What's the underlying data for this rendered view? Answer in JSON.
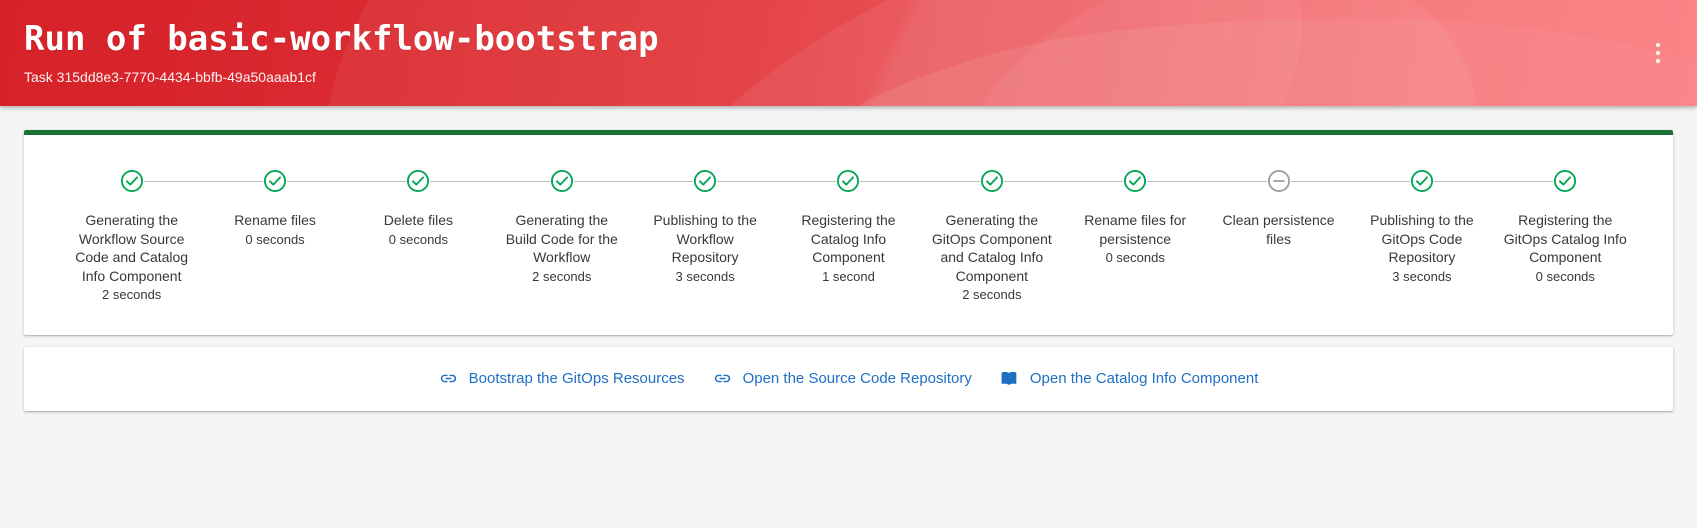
{
  "header": {
    "title": "Run of basic-workflow-bootstrap",
    "subtitle": "Task 315dd8e3-7770-4434-bbfb-49a50aaab1cf",
    "menu_icon": "kebab-vertical-icon",
    "gradient_from": "#d62128",
    "gradient_to": "#fa7175"
  },
  "card": {
    "accent_color": "#1a7037"
  },
  "colors": {
    "step_success": "#00a651",
    "step_skipped": "#9e9e9e",
    "connector": "#bdbdbd",
    "link": "#1f6fc4",
    "text": "#35393d"
  },
  "stepper": {
    "steps": [
      {
        "label": "Generating the Workflow Source Code and Catalog Info Component",
        "time": "2 seconds",
        "status": "success",
        "icon": "check-circle-icon"
      },
      {
        "label": "Rename files",
        "time": "0 seconds",
        "status": "success",
        "icon": "check-circle-icon"
      },
      {
        "label": "Delete files",
        "time": "0 seconds",
        "status": "success",
        "icon": "check-circle-icon"
      },
      {
        "label": "Generating the Build Code for the Workflow",
        "time": "2 seconds",
        "status": "success",
        "icon": "check-circle-icon"
      },
      {
        "label": "Publishing to the Workflow Repository",
        "time": "3 seconds",
        "status": "success",
        "icon": "check-circle-icon"
      },
      {
        "label": "Registering the Catalog Info Component",
        "time": "1 second",
        "status": "success",
        "icon": "check-circle-icon"
      },
      {
        "label": "Generating the GitOps Component and Catalog Info Component",
        "time": "2 seconds",
        "status": "success",
        "icon": "check-circle-icon"
      },
      {
        "label": "Rename files for persistence",
        "time": "0 seconds",
        "status": "success",
        "icon": "check-circle-icon"
      },
      {
        "label": "Clean persistence files",
        "time": "",
        "status": "skipped",
        "icon": "minus-circle-icon"
      },
      {
        "label": "Publishing to the GitOps Code Repository",
        "time": "3 seconds",
        "status": "success",
        "icon": "check-circle-icon"
      },
      {
        "label": "Registering the GitOps Catalog Info Component",
        "time": "0 seconds",
        "status": "success",
        "icon": "check-circle-icon"
      }
    ]
  },
  "links": [
    {
      "label": "Bootstrap the GitOps Resources",
      "icon": "link-chain-icon"
    },
    {
      "label": "Open the Source Code Repository",
      "icon": "link-chain-icon"
    },
    {
      "label": "Open the Catalog Info Component",
      "icon": "menu-book-icon"
    }
  ]
}
